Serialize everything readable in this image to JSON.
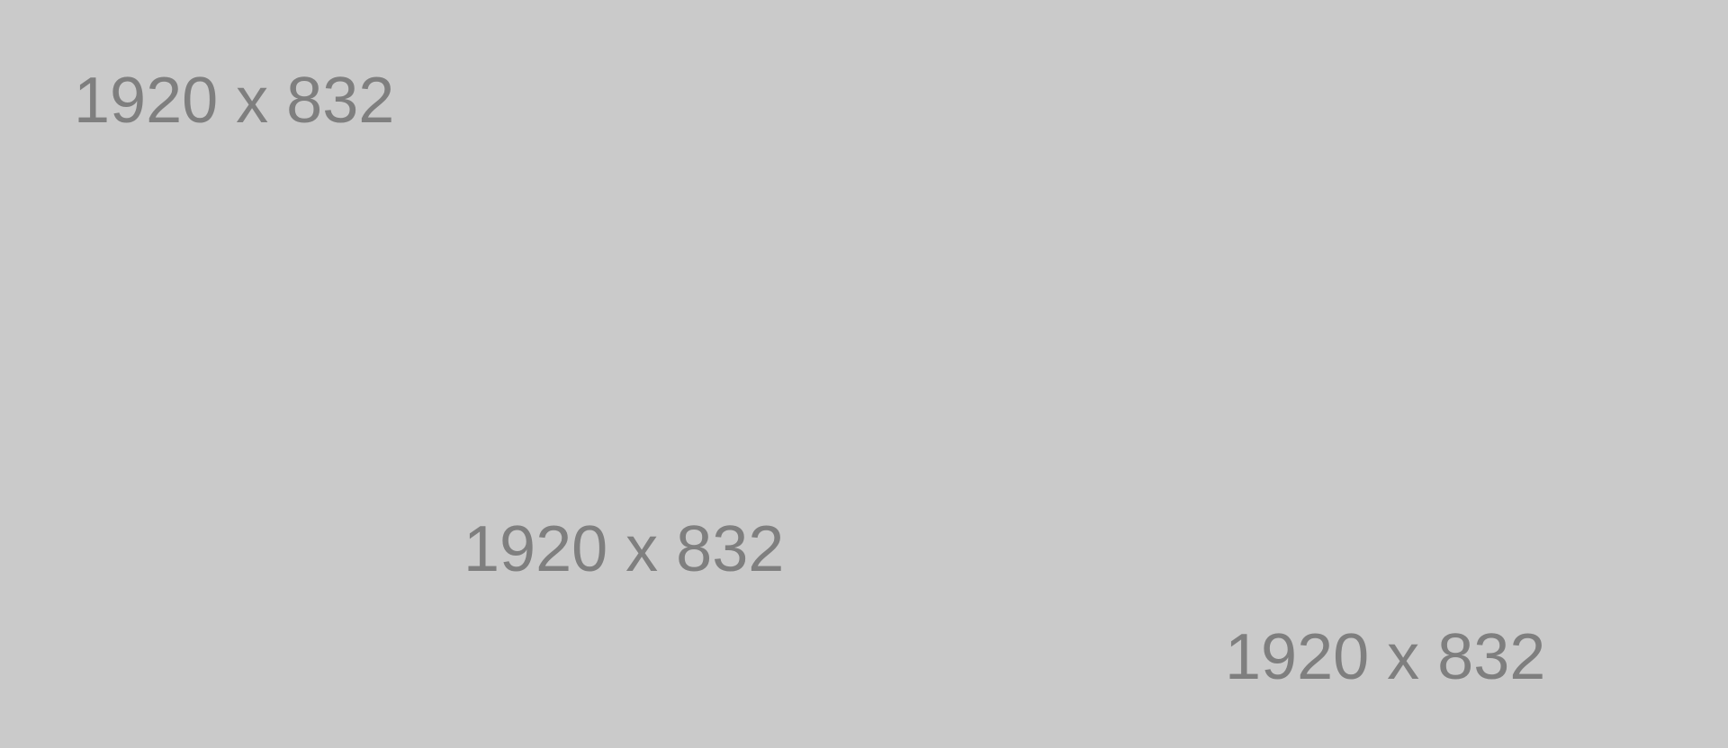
{
  "placeholder": {
    "background_color": "#cacaca",
    "text_color": "#7f7f7f",
    "labels": [
      "1920 x 832",
      "1920 x 832",
      "1920 x 832"
    ]
  }
}
